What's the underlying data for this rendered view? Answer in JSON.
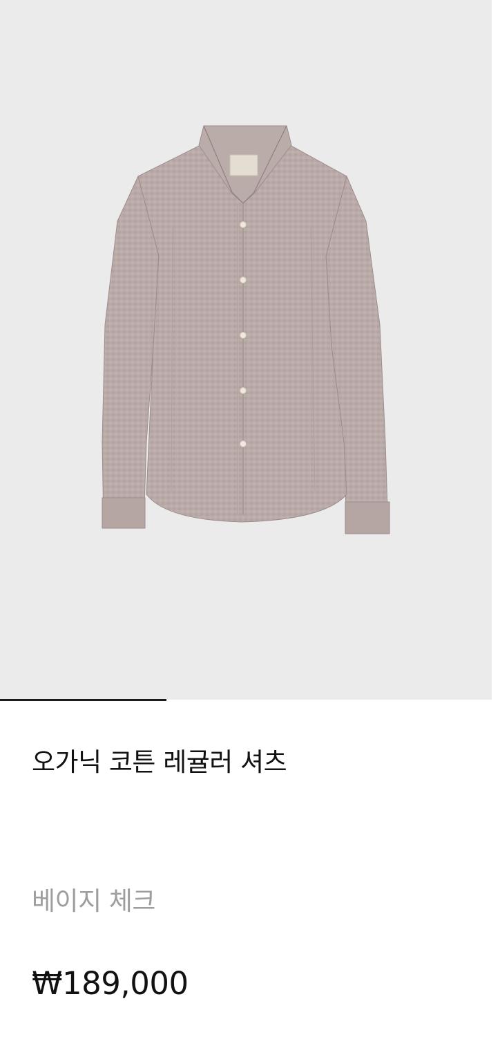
{
  "product": {
    "image": {
      "icon": "shirt-icon",
      "background_color": "#ebebeb",
      "shirt_color": "#b3a3a1"
    },
    "gallery": {
      "current_slide": 1,
      "total_slides": 3
    },
    "name": "오가닉 코튼 레귤러 셔츠",
    "color": "베이지 체크",
    "price": "₩189,000"
  }
}
